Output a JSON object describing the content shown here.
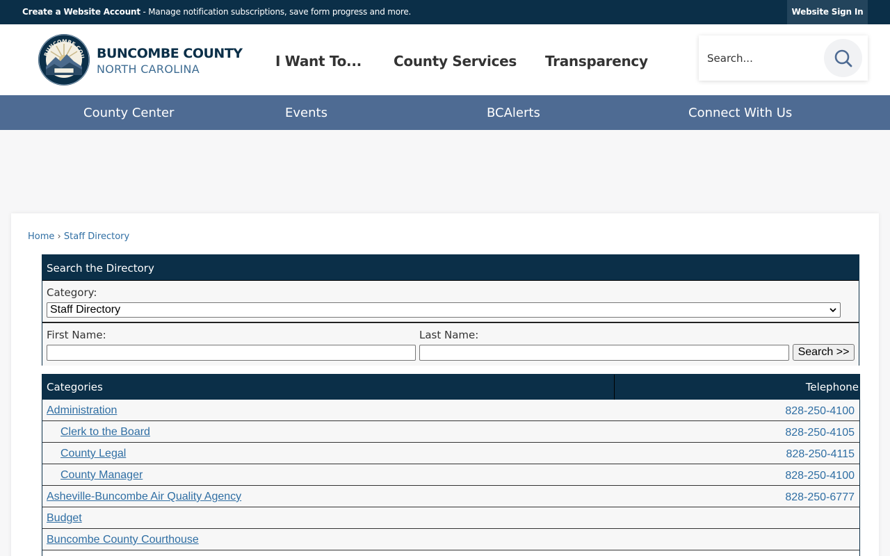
{
  "topbar": {
    "account_bold": "Create a Website Account",
    "account_rest": " - Manage notification subscriptions, save form progress and more.",
    "signin_label": "Website Sign In"
  },
  "logo": {
    "title": "BUNCOMBE COUNTY",
    "subtitle": "NORTH CAROLINA",
    "seal_text": "BUNCOMBE COUNTY"
  },
  "main_nav": [
    "I Want To...",
    "County Services",
    "Transparency"
  ],
  "search": {
    "placeholder": "Search..."
  },
  "sub_nav": [
    "County Center",
    "Events",
    "BCAlerts",
    "Connect With Us"
  ],
  "breadcrumb": {
    "home": "Home",
    "separator": "›",
    "current": "Staff Directory"
  },
  "directory_search": {
    "title": "Search the Directory",
    "category_label": "Category:",
    "category_selected": "Staff Directory",
    "first_name_label": "First Name:",
    "last_name_label": "Last Name:",
    "search_button": "Search >>"
  },
  "categories_table": {
    "col_categories": "Categories",
    "col_telephone": "Telephone",
    "rows": [
      {
        "name": "Administration",
        "phone": "828-250-4100",
        "indent": false
      },
      {
        "name": "Clerk to the Board",
        "phone": "828-250-4105",
        "indent": true
      },
      {
        "name": "County Legal",
        "phone": "828-250-4115",
        "indent": true
      },
      {
        "name": "County Manager",
        "phone": "828-250-4100",
        "indent": true
      },
      {
        "name": "Asheville-Buncombe Air Quality Agency",
        "phone": "828-250-6777",
        "indent": false
      },
      {
        "name": "Budget",
        "phone": "",
        "indent": false
      },
      {
        "name": "Buncombe County Courthouse",
        "phone": "",
        "indent": false
      }
    ]
  },
  "colors": {
    "navy": "#0b2f48",
    "subnav": "#4e6b93",
    "link": "#2f6ea3"
  }
}
